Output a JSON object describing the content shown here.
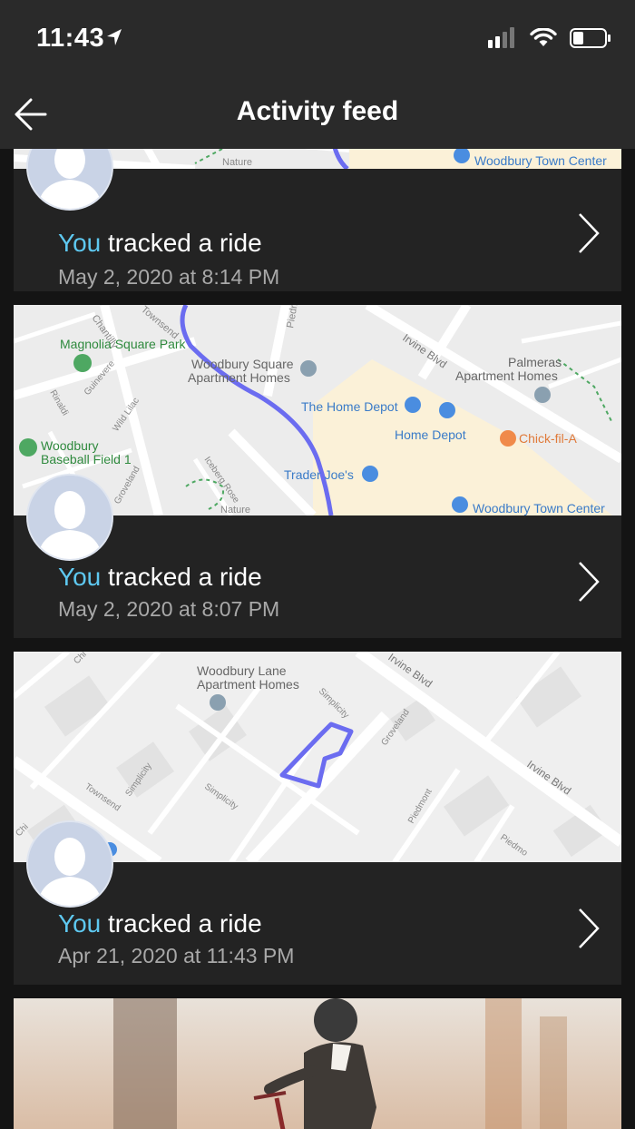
{
  "status_bar": {
    "time": "11:43"
  },
  "header": {
    "title": "Activity feed"
  },
  "feed": {
    "items": [
      {
        "actor": "You",
        "action": "tracked a ride",
        "date": "May 2, 2020 at 8:14 PM",
        "map_labels": [
          "Nature",
          "Woodbury Town Center"
        ]
      },
      {
        "actor": "You",
        "action": "tracked a ride",
        "date": "May 2, 2020 at 8:07 PM",
        "map_labels": [
          "Chantilly",
          "Townsend",
          "Piedmont",
          "Magnolia Square Park",
          "Woodbury Square",
          "Apartment Homes",
          "Irvine Blvd",
          "Palmeras",
          "Apartment Homes",
          "Rinaldi",
          "Guinevere",
          "Wild Lilac",
          "The Home Depot",
          "Home Depot",
          "Chick-fil-A",
          "Woodbury",
          "Baseball Field 1",
          "Groveland",
          "Iceberg Rose",
          "Trader Joe's",
          "Nature",
          "Woodbury Town Center"
        ]
      },
      {
        "actor": "You",
        "action": "tracked a ride",
        "date": "Apr 21, 2020 at 11:43 PM",
        "map_labels": [
          "Chi",
          "Woodbury Lane",
          "Apartment Homes",
          "Irvine Blvd",
          "Simplicity",
          "Groveland",
          "Irvine Blvd",
          "Simplicity",
          "Townsend",
          "Simplicity",
          "Piedmont",
          "Piedmo",
          "Chi"
        ]
      }
    ]
  },
  "colors": {
    "accent": "#5ec8f0",
    "route": "#6b6cf0",
    "card": "#232323",
    "bar": "#2a2a2a"
  }
}
